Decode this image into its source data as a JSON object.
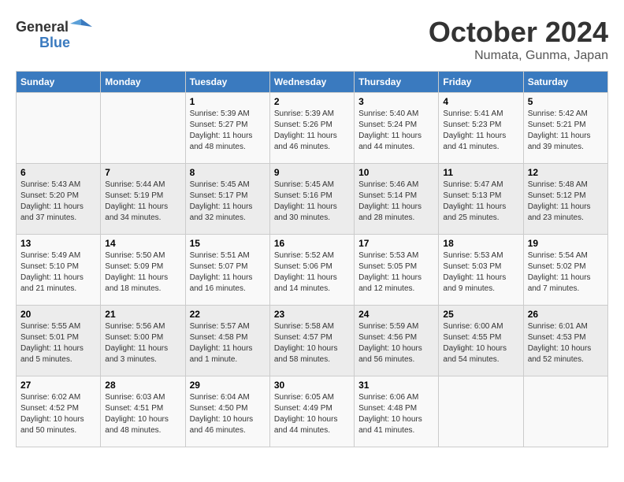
{
  "header": {
    "logo_general": "General",
    "logo_blue": "Blue",
    "month": "October 2024",
    "location": "Numata, Gunma, Japan"
  },
  "days_of_week": [
    "Sunday",
    "Monday",
    "Tuesday",
    "Wednesday",
    "Thursday",
    "Friday",
    "Saturday"
  ],
  "weeks": [
    [
      {
        "day": "",
        "info": ""
      },
      {
        "day": "",
        "info": ""
      },
      {
        "day": "1",
        "info": "Sunrise: 5:39 AM\nSunset: 5:27 PM\nDaylight: 11 hours and 48 minutes."
      },
      {
        "day": "2",
        "info": "Sunrise: 5:39 AM\nSunset: 5:26 PM\nDaylight: 11 hours and 46 minutes."
      },
      {
        "day": "3",
        "info": "Sunrise: 5:40 AM\nSunset: 5:24 PM\nDaylight: 11 hours and 44 minutes."
      },
      {
        "day": "4",
        "info": "Sunrise: 5:41 AM\nSunset: 5:23 PM\nDaylight: 11 hours and 41 minutes."
      },
      {
        "day": "5",
        "info": "Sunrise: 5:42 AM\nSunset: 5:21 PM\nDaylight: 11 hours and 39 minutes."
      }
    ],
    [
      {
        "day": "6",
        "info": "Sunrise: 5:43 AM\nSunset: 5:20 PM\nDaylight: 11 hours and 37 minutes."
      },
      {
        "day": "7",
        "info": "Sunrise: 5:44 AM\nSunset: 5:19 PM\nDaylight: 11 hours and 34 minutes."
      },
      {
        "day": "8",
        "info": "Sunrise: 5:45 AM\nSunset: 5:17 PM\nDaylight: 11 hours and 32 minutes."
      },
      {
        "day": "9",
        "info": "Sunrise: 5:45 AM\nSunset: 5:16 PM\nDaylight: 11 hours and 30 minutes."
      },
      {
        "day": "10",
        "info": "Sunrise: 5:46 AM\nSunset: 5:14 PM\nDaylight: 11 hours and 28 minutes."
      },
      {
        "day": "11",
        "info": "Sunrise: 5:47 AM\nSunset: 5:13 PM\nDaylight: 11 hours and 25 minutes."
      },
      {
        "day": "12",
        "info": "Sunrise: 5:48 AM\nSunset: 5:12 PM\nDaylight: 11 hours and 23 minutes."
      }
    ],
    [
      {
        "day": "13",
        "info": "Sunrise: 5:49 AM\nSunset: 5:10 PM\nDaylight: 11 hours and 21 minutes."
      },
      {
        "day": "14",
        "info": "Sunrise: 5:50 AM\nSunset: 5:09 PM\nDaylight: 11 hours and 18 minutes."
      },
      {
        "day": "15",
        "info": "Sunrise: 5:51 AM\nSunset: 5:07 PM\nDaylight: 11 hours and 16 minutes."
      },
      {
        "day": "16",
        "info": "Sunrise: 5:52 AM\nSunset: 5:06 PM\nDaylight: 11 hours and 14 minutes."
      },
      {
        "day": "17",
        "info": "Sunrise: 5:53 AM\nSunset: 5:05 PM\nDaylight: 11 hours and 12 minutes."
      },
      {
        "day": "18",
        "info": "Sunrise: 5:53 AM\nSunset: 5:03 PM\nDaylight: 11 hours and 9 minutes."
      },
      {
        "day": "19",
        "info": "Sunrise: 5:54 AM\nSunset: 5:02 PM\nDaylight: 11 hours and 7 minutes."
      }
    ],
    [
      {
        "day": "20",
        "info": "Sunrise: 5:55 AM\nSunset: 5:01 PM\nDaylight: 11 hours and 5 minutes."
      },
      {
        "day": "21",
        "info": "Sunrise: 5:56 AM\nSunset: 5:00 PM\nDaylight: 11 hours and 3 minutes."
      },
      {
        "day": "22",
        "info": "Sunrise: 5:57 AM\nSunset: 4:58 PM\nDaylight: 11 hours and 1 minute."
      },
      {
        "day": "23",
        "info": "Sunrise: 5:58 AM\nSunset: 4:57 PM\nDaylight: 10 hours and 58 minutes."
      },
      {
        "day": "24",
        "info": "Sunrise: 5:59 AM\nSunset: 4:56 PM\nDaylight: 10 hours and 56 minutes."
      },
      {
        "day": "25",
        "info": "Sunrise: 6:00 AM\nSunset: 4:55 PM\nDaylight: 10 hours and 54 minutes."
      },
      {
        "day": "26",
        "info": "Sunrise: 6:01 AM\nSunset: 4:53 PM\nDaylight: 10 hours and 52 minutes."
      }
    ],
    [
      {
        "day": "27",
        "info": "Sunrise: 6:02 AM\nSunset: 4:52 PM\nDaylight: 10 hours and 50 minutes."
      },
      {
        "day": "28",
        "info": "Sunrise: 6:03 AM\nSunset: 4:51 PM\nDaylight: 10 hours and 48 minutes."
      },
      {
        "day": "29",
        "info": "Sunrise: 6:04 AM\nSunset: 4:50 PM\nDaylight: 10 hours and 46 minutes."
      },
      {
        "day": "30",
        "info": "Sunrise: 6:05 AM\nSunset: 4:49 PM\nDaylight: 10 hours and 44 minutes."
      },
      {
        "day": "31",
        "info": "Sunrise: 6:06 AM\nSunset: 4:48 PM\nDaylight: 10 hours and 41 minutes."
      },
      {
        "day": "",
        "info": ""
      },
      {
        "day": "",
        "info": ""
      }
    ]
  ]
}
